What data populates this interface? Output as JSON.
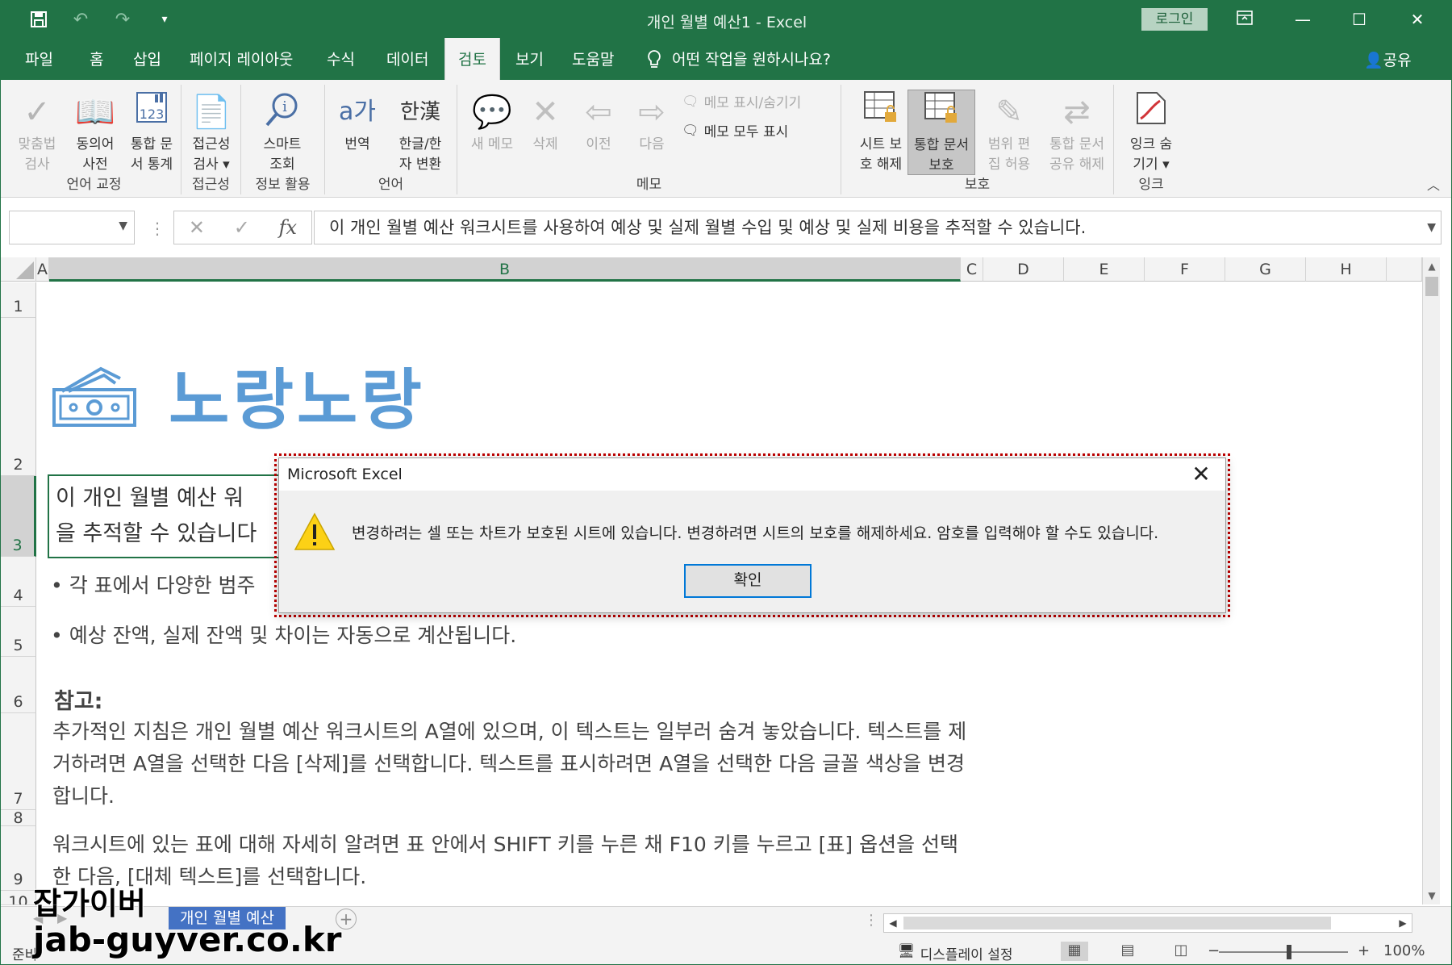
{
  "window": {
    "title": "개인 월별 예산1 - Excel",
    "login_label": "로그인"
  },
  "tabs": [
    {
      "label": "파일"
    },
    {
      "label": "홈"
    },
    {
      "label": "삽입"
    },
    {
      "label": "페이지 레이아웃"
    },
    {
      "label": "수식"
    },
    {
      "label": "데이터"
    },
    {
      "label": "검토",
      "active": true
    },
    {
      "label": "보기"
    },
    {
      "label": "도움말"
    }
  ],
  "tellme": "어떤 작업을 원하시나요?",
  "share": "공유",
  "ribbon": {
    "groups": {
      "proofing": "언어 교정",
      "accessibility": "접근성",
      "insights": "정보 활용",
      "language": "언어",
      "comments": "메모",
      "protect": "보호",
      "ink": "잉크"
    },
    "buttons": {
      "spelling_1": "맞춤법",
      "spelling_2": "검사",
      "thesaurus_1": "동의어",
      "thesaurus_2": "사전",
      "workbook_stats_1": "통합 문",
      "workbook_stats_2": "서 통계",
      "check_access_1": "접근성",
      "check_access_2": "검사 ▾",
      "smart_lookup_1": "스마트",
      "smart_lookup_2": "조회",
      "translate": "번역",
      "hangul_hanja_1": "한글/한",
      "hangul_hanja_2": "자 변환",
      "new_comment": "새 메모",
      "delete": "삭제",
      "previous": "이전",
      "next": "다음",
      "show_hide_comment": "메모 표시/숨기기",
      "show_all_comments": "메모 모두 표시",
      "unprotect_sheet_1": "시트 보",
      "unprotect_sheet_2": "호 해제",
      "protect_workbook_1": "통합 문서",
      "protect_workbook_2": "보호",
      "allow_edit_1": "범위 편",
      "allow_edit_2": "집 허용",
      "unshare_1": "통합 문서",
      "unshare_2": "공유 해제",
      "hide_ink_1": "잉크 숨",
      "hide_ink_2": "기기 ▾"
    }
  },
  "formula_bar": {
    "name_box": "",
    "formula": "이 개인 월별 예산 워크시트를 사용하여 예상 및 실제 월별 수입 및 예상 및 실제 비용을 추적할 수 있습니다."
  },
  "columns": [
    "A",
    "B",
    "C",
    "D",
    "E",
    "F",
    "G",
    "H"
  ],
  "rows": [
    "1",
    "2",
    "3",
    "4",
    "5",
    "6",
    "7",
    "8",
    "9",
    "10"
  ],
  "sheet": {
    "brand": "노랑노랑",
    "desc_line1": "이 개인 월별 예산 워",
    "desc_line2": "을 추적할 수 있습니다",
    "bullet1": "• 각 표에서 다양한 범주",
    "bullet2": "• 예상 잔액, 실제 잔액 및 차이는 자동으로 계산됩니다.",
    "note_heading": "참고:",
    "note_p1": "추가적인 지침은 개인 월별 예산 워크시트의 A열에 있으며, 이 텍스트는 일부러 숨겨 놓았습니다. 텍스트를 제거하려면 A열을 선택한 다음 [삭제]를 선택합니다. 텍스트를 표시하려면 A열을 선택한 다음 글꼴 색상을 변경합니다.",
    "note_p2": "워크시트에 있는 표에 대해 자세히 알려면 표 안에서 SHIFT 키를 누른 채 F10 키를 누르고 [표] 옵션을 선택한 다음, [대체 텍스트]를 선택합니다."
  },
  "sheet_tab": "개인 월별 예산",
  "status": {
    "ready": "준비",
    "display_settings": "디스플레이 설정",
    "zoom": "100%"
  },
  "dialog": {
    "title": "Microsoft Excel",
    "message": "변경하려는 셀 또는 차트가 보호된 시트에 있습니다. 변경하려면 시트의 보호를 해제하세요. 암호를 입력해야 할 수도 있습니다.",
    "ok": "확인"
  },
  "watermark": {
    "korean": "잡가이버",
    "domain": "jab-guyver.co.kr"
  },
  "colors": {
    "excel_green": "#217346",
    "brand_blue": "#5b9bd5",
    "dialog_highlight": "#c00000"
  }
}
